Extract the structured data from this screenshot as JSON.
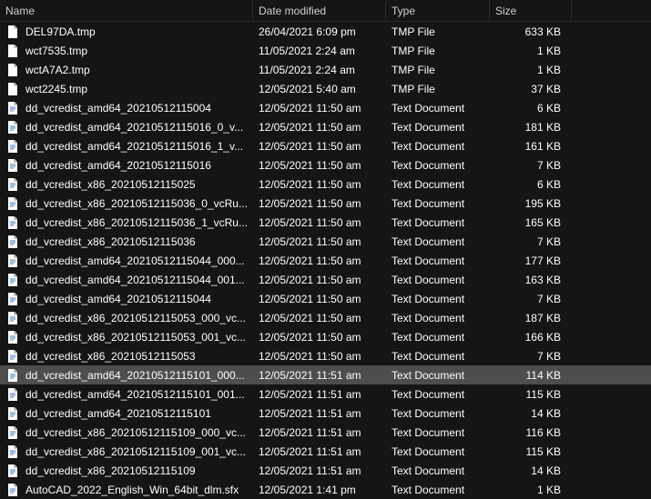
{
  "columns": {
    "name": "Name",
    "date": "Date modified",
    "type": "Type",
    "size": "Size"
  },
  "icons": {
    "blank": "blank-file-icon",
    "text": "text-file-icon",
    "generic": "generic-file-icon"
  },
  "selected_index": 18,
  "files": [
    {
      "name": "DEL97DA.tmp",
      "date": "26/04/2021 6:09 pm",
      "type": "TMP File",
      "size": "633 KB",
      "icon": "blank"
    },
    {
      "name": "wct7535.tmp",
      "date": "11/05/2021 2:24 am",
      "type": "TMP File",
      "size": "1 KB",
      "icon": "blank"
    },
    {
      "name": "wctA7A2.tmp",
      "date": "11/05/2021 2:24 am",
      "type": "TMP File",
      "size": "1 KB",
      "icon": "blank"
    },
    {
      "name": "wct2245.tmp",
      "date": "12/05/2021 5:40 am",
      "type": "TMP File",
      "size": "37 KB",
      "icon": "blank"
    },
    {
      "name": "dd_vcredist_amd64_20210512115004",
      "date": "12/05/2021 11:50 am",
      "type": "Text Document",
      "size": "6 KB",
      "icon": "text"
    },
    {
      "name": "dd_vcredist_amd64_20210512115016_0_v...",
      "date": "12/05/2021 11:50 am",
      "type": "Text Document",
      "size": "181 KB",
      "icon": "text"
    },
    {
      "name": "dd_vcredist_amd64_20210512115016_1_v...",
      "date": "12/05/2021 11:50 am",
      "type": "Text Document",
      "size": "161 KB",
      "icon": "text"
    },
    {
      "name": "dd_vcredist_amd64_20210512115016",
      "date": "12/05/2021 11:50 am",
      "type": "Text Document",
      "size": "7 KB",
      "icon": "text"
    },
    {
      "name": "dd_vcredist_x86_20210512115025",
      "date": "12/05/2021 11:50 am",
      "type": "Text Document",
      "size": "6 KB",
      "icon": "text"
    },
    {
      "name": "dd_vcredist_x86_20210512115036_0_vcRu...",
      "date": "12/05/2021 11:50 am",
      "type": "Text Document",
      "size": "195 KB",
      "icon": "text"
    },
    {
      "name": "dd_vcredist_x86_20210512115036_1_vcRu...",
      "date": "12/05/2021 11:50 am",
      "type": "Text Document",
      "size": "165 KB",
      "icon": "text"
    },
    {
      "name": "dd_vcredist_x86_20210512115036",
      "date": "12/05/2021 11:50 am",
      "type": "Text Document",
      "size": "7 KB",
      "icon": "text"
    },
    {
      "name": "dd_vcredist_amd64_20210512115044_000...",
      "date": "12/05/2021 11:50 am",
      "type": "Text Document",
      "size": "177 KB",
      "icon": "text"
    },
    {
      "name": "dd_vcredist_amd64_20210512115044_001...",
      "date": "12/05/2021 11:50 am",
      "type": "Text Document",
      "size": "163 KB",
      "icon": "text"
    },
    {
      "name": "dd_vcredist_amd64_20210512115044",
      "date": "12/05/2021 11:50 am",
      "type": "Text Document",
      "size": "7 KB",
      "icon": "text"
    },
    {
      "name": "dd_vcredist_x86_20210512115053_000_vc...",
      "date": "12/05/2021 11:50 am",
      "type": "Text Document",
      "size": "187 KB",
      "icon": "text"
    },
    {
      "name": "dd_vcredist_x86_20210512115053_001_vc...",
      "date": "12/05/2021 11:50 am",
      "type": "Text Document",
      "size": "166 KB",
      "icon": "text"
    },
    {
      "name": "dd_vcredist_x86_20210512115053",
      "date": "12/05/2021 11:50 am",
      "type": "Text Document",
      "size": "7 KB",
      "icon": "text"
    },
    {
      "name": "dd_vcredist_amd64_20210512115101_000...",
      "date": "12/05/2021 11:51 am",
      "type": "Text Document",
      "size": "114 KB",
      "icon": "text"
    },
    {
      "name": "dd_vcredist_amd64_20210512115101_001...",
      "date": "12/05/2021 11:51 am",
      "type": "Text Document",
      "size": "115 KB",
      "icon": "text"
    },
    {
      "name": "dd_vcredist_amd64_20210512115101",
      "date": "12/05/2021 11:51 am",
      "type": "Text Document",
      "size": "14 KB",
      "icon": "text"
    },
    {
      "name": "dd_vcredist_x86_20210512115109_000_vc...",
      "date": "12/05/2021 11:51 am",
      "type": "Text Document",
      "size": "116 KB",
      "icon": "text"
    },
    {
      "name": "dd_vcredist_x86_20210512115109_001_vc...",
      "date": "12/05/2021 11:51 am",
      "type": "Text Document",
      "size": "115 KB",
      "icon": "text"
    },
    {
      "name": "dd_vcredist_x86_20210512115109",
      "date": "12/05/2021 11:51 am",
      "type": "Text Document",
      "size": "14 KB",
      "icon": "text"
    },
    {
      "name": "AutoCAD_2022_English_Win_64bit_dlm.sfx",
      "date": "12/05/2021 1:41 pm",
      "type": "Text Document",
      "size": "1 KB",
      "icon": "text"
    }
  ]
}
